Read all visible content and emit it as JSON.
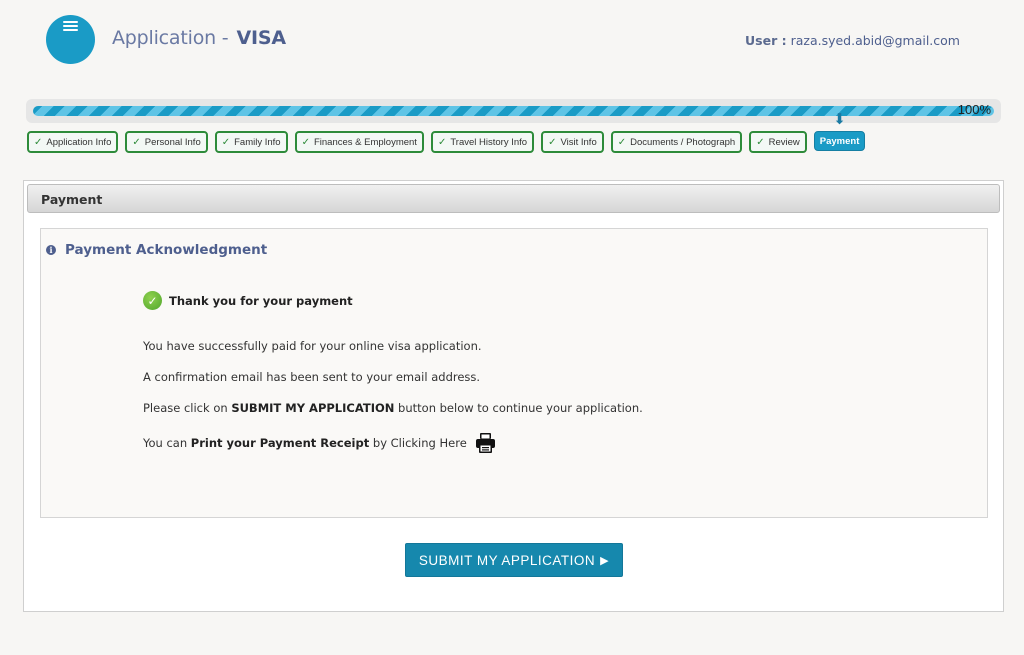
{
  "header": {
    "app_title": "Application -",
    "app_type": "VISA",
    "user_label": "User :",
    "user_email": "raza.syed.abid@gmail.com",
    "menu_icon": "hamburger-menu-icon"
  },
  "progress": {
    "value_percent": 100,
    "label": "100%"
  },
  "steps": [
    {
      "label": "Application Info",
      "status": "done",
      "check": "✓"
    },
    {
      "label": "Personal Info",
      "status": "done",
      "check": "✓"
    },
    {
      "label": "Family Info",
      "status": "done",
      "check": "✓"
    },
    {
      "label": "Finances & Employment",
      "status": "done",
      "check": "✓"
    },
    {
      "label": "Travel History Info",
      "status": "done",
      "check": "✓"
    },
    {
      "label": "Visit Info",
      "status": "done",
      "check": "✓"
    },
    {
      "label": "Documents / Photograph",
      "status": "done",
      "check": "✓"
    },
    {
      "label": "Review",
      "status": "done",
      "check": "✓"
    },
    {
      "label": "Payment",
      "status": "active",
      "indicator": "⬇"
    }
  ],
  "panel": {
    "heading": "Payment",
    "section_title": "Payment Acknowledgment",
    "info_icon_glyph": "i",
    "thanks": "Thank you for your payment",
    "check_glyph": "✓",
    "line1": "You have successfully paid for your online visa application.",
    "line2": "A confirmation email has been sent to your email address.",
    "line3_pre": "Please click on ",
    "line3_bold": "SUBMIT MY APPLICATION",
    "line3_post": " button below to continue your application.",
    "line4_pre": "You can ",
    "line4_bold": "Print your Payment Receipt",
    "line4_post": " by Clicking Here"
  },
  "submit_button": {
    "label": "SUBMIT MY APPLICATION",
    "icon": "▶"
  },
  "colors": {
    "brand": "#1a9bc6",
    "step_done_border": "#2e8b3a",
    "title_text": "#4e5f8e"
  }
}
